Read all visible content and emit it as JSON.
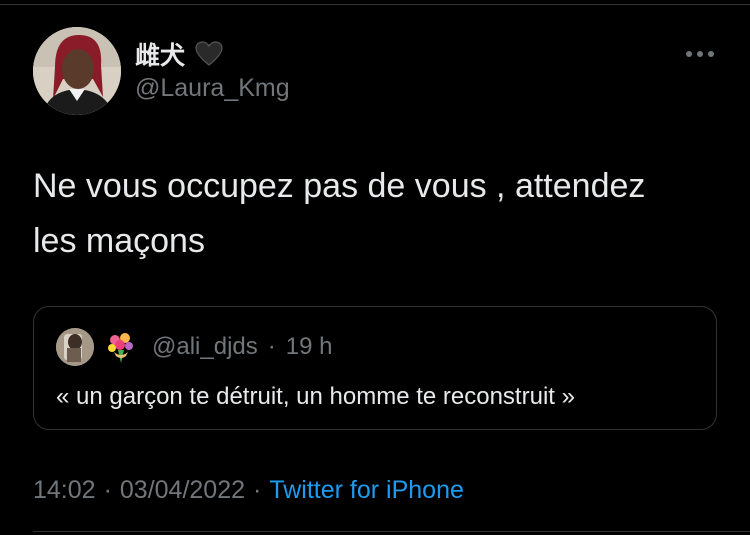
{
  "author": {
    "display_name": "雌犬",
    "handle": "@Laura_Kmg",
    "emoji_icon": "black-heart-icon"
  },
  "tweet": {
    "text": "Ne vous occupez pas de vous , attendez\nles maçons"
  },
  "quoted_tweet": {
    "emoji_icon": "bouquet-icon",
    "handle": "@ali_djds",
    "separator": "·",
    "time": "19 h",
    "text": "« un garçon te détruit, un homme te reconstruit »"
  },
  "meta": {
    "time": "14:02",
    "sep1": "·",
    "date": "03/04/2022",
    "sep2": "·",
    "source": "Twitter for iPhone"
  },
  "colors": {
    "background": "#000000",
    "text": "#e7e9ea",
    "secondary": "#71767b",
    "accent": "#1d9bf0",
    "border": "#2f3336"
  }
}
